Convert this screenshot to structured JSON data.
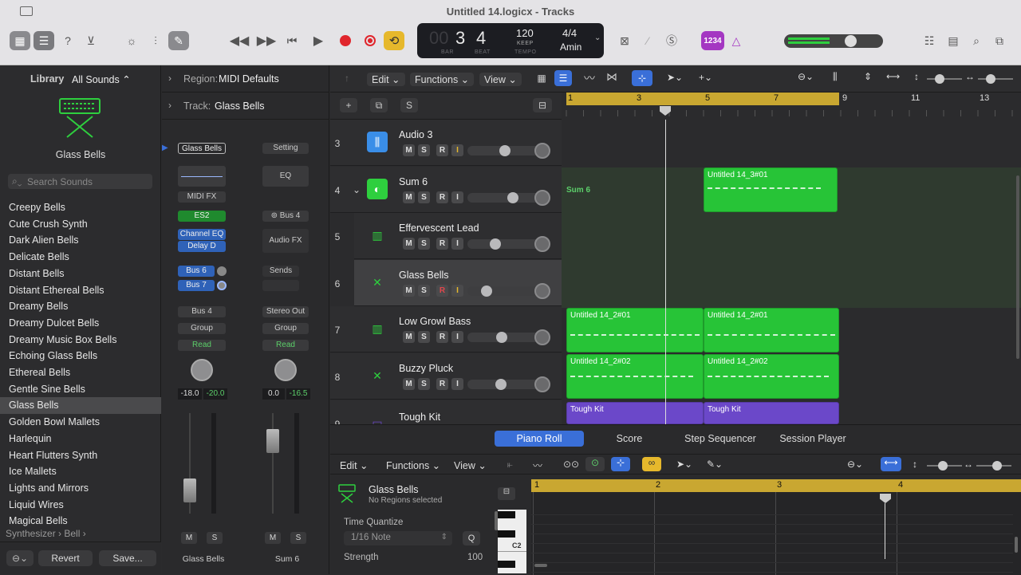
{
  "window": {
    "title": "Untitled 14.logicx - Tracks"
  },
  "lcd": {
    "bar": "3",
    "beat": "4",
    "bar_label": "BAR",
    "beat_label": "BEAT",
    "tempo": "120",
    "keep": "KEEP",
    "tempo_label": "TEMPO",
    "signature": "4/4",
    "key": "Amin",
    "bar_dim": "00"
  },
  "toolbar": {
    "count_in": "1234"
  },
  "library": {
    "title": "Library",
    "dropdown": "All Sounds",
    "selected_patch": "Glass Bells",
    "search_placeholder": "Search Sounds",
    "items": [
      "Creepy Bells",
      "Cute Crush Synth",
      "Dark Alien Bells",
      "Delicate Bells",
      "Distant Bells",
      "Distant Ethereal Bells",
      "Dreamy Bells",
      "Dreamy Dulcet Bells",
      "Dreamy Music Box Bells",
      "Echoing Glass Bells",
      "Ethereal Bells",
      "Gentle Sine Bells",
      "Glass Bells",
      "Golden Bowl Mallets",
      "Harlequin",
      "Heart Flutters Synth",
      "Ice Mallets",
      "Lights and Mirrors",
      "Liquid Wires",
      "Magical Bells"
    ],
    "breadcrumb": "Synthesizer › Bell ›",
    "revert": "Revert",
    "save": "Save..."
  },
  "inspector": {
    "region_label": "Region:",
    "region_value": "MIDI Defaults",
    "track_label": "Track:",
    "track_value": "Glass Bells",
    "strip1": {
      "name": "Glass Bells",
      "midifx": "MIDI FX",
      "instrument": "ES2",
      "fx1": "Channel EQ",
      "fx2": "Delay D",
      "send1": "Bus 6",
      "send2": "Bus 7",
      "output": "Bus 4",
      "group": "Group",
      "auto": "Read",
      "vol": "-18.0",
      "peak": "-20.0",
      "m": "M",
      "s": "S",
      "footer": "Glass Bells"
    },
    "strip2": {
      "setting": "Setting",
      "eq": "EQ",
      "input": "Bus 4",
      "audiofx": "Audio FX",
      "sends": "Sends",
      "output": "Stereo Out",
      "group": "Group",
      "auto": "Read",
      "vol": "0.0",
      "peak": "-16.5",
      "m": "M",
      "s": "S",
      "footer": "Sum 6"
    }
  },
  "tracks_header": {
    "edit": "Edit",
    "functions": "Functions",
    "view": "View",
    "solo_btn": "S"
  },
  "ruler": {
    "marks": [
      "1",
      "3",
      "5",
      "7",
      "9",
      "11",
      "13"
    ]
  },
  "tracks": [
    {
      "num": "3",
      "name": "Audio 3",
      "m": "M",
      "s": "S",
      "r": "R",
      "i": "I"
    },
    {
      "num": "4",
      "name": "Sum 6",
      "m": "M",
      "s": "S",
      "r": "R",
      "i": "I"
    },
    {
      "num": "5",
      "name": "Effervescent Lead",
      "m": "M",
      "s": "S",
      "r": "R",
      "i": "I"
    },
    {
      "num": "6",
      "name": "Glass Bells",
      "m": "M",
      "s": "S",
      "r": "R",
      "i": "I"
    },
    {
      "num": "7",
      "name": "Low Growl Bass",
      "m": "M",
      "s": "S",
      "r": "R",
      "i": "I"
    },
    {
      "num": "8",
      "name": "Buzzy Pluck",
      "m": "M",
      "s": "S",
      "r": "R",
      "i": "I"
    },
    {
      "num": "9",
      "name": "Tough Kit"
    }
  ],
  "regions": {
    "sum_label": "Sum 6",
    "r1": "Untitled 14_3#01",
    "r2": "Untitled 14_2#01",
    "r3": "Untitled 14_2#01",
    "r4": "Untitled 14_2#02",
    "r5": "Untitled 14_2#02",
    "r6": "Tough Kit",
    "r7": "Tough Kit"
  },
  "editor": {
    "tabs": [
      "Piano Roll",
      "Score",
      "Step Sequencer",
      "Session Player"
    ],
    "edit": "Edit",
    "functions": "Functions",
    "view": "View",
    "track_name": "Glass Bells",
    "track_sub": "No Regions selected",
    "time_quantize": "Time Quantize",
    "quantize_value": "1/16 Note",
    "q_btn": "Q",
    "strength": "Strength",
    "strength_value": "100",
    "c2": "C2",
    "ruler": [
      "1",
      "2",
      "3",
      "4"
    ]
  }
}
